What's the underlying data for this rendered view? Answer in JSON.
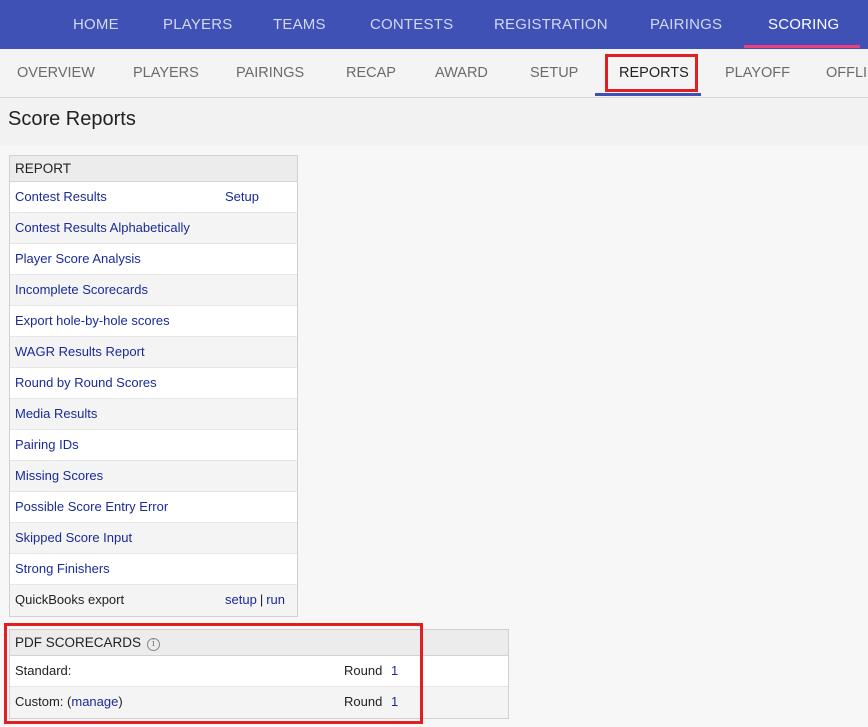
{
  "top_nav": {
    "items": [
      {
        "label": "HOME"
      },
      {
        "label": "PLAYERS"
      },
      {
        "label": "TEAMS"
      },
      {
        "label": "CONTESTS"
      },
      {
        "label": "REGISTRATION"
      },
      {
        "label": "PAIRINGS"
      },
      {
        "label": "SCORING",
        "active": true
      }
    ]
  },
  "sub_nav": {
    "items": [
      {
        "label": "OVERVIEW"
      },
      {
        "label": "PLAYERS"
      },
      {
        "label": "PAIRINGS"
      },
      {
        "label": "RECAP"
      },
      {
        "label": "AWARD"
      },
      {
        "label": "SETUP"
      },
      {
        "label": "REPORTS",
        "active": true
      },
      {
        "label": "PLAYOFF"
      },
      {
        "label": "OFFLI"
      }
    ]
  },
  "page": {
    "title": "Score Reports"
  },
  "report_panel": {
    "header": "REPORT",
    "rows": [
      {
        "label": "Contest Results",
        "setup": "Setup"
      },
      {
        "label": "Contest Results Alphabetically"
      },
      {
        "label": "Player Score Analysis"
      },
      {
        "label": "Incomplete Scorecards"
      },
      {
        "label": "Export hole-by-hole scores"
      },
      {
        "label": "WAGR Results Report"
      },
      {
        "label": "Round by Round Scores"
      },
      {
        "label": "Media Results"
      },
      {
        "label": "Pairing IDs"
      },
      {
        "label": "Missing Scores"
      },
      {
        "label": "Possible Score Entry Error"
      },
      {
        "label": "Skipped Score Input"
      },
      {
        "label": "Strong Finishers"
      }
    ],
    "quickbooks": {
      "label": "QuickBooks export",
      "setup": "setup",
      "sep": "|",
      "run": "run"
    }
  },
  "pdf_panel": {
    "header": "PDF SCORECARDS",
    "info_glyph": "i",
    "standard": {
      "label": "Standard:",
      "round_label": "Round",
      "round_value": "1"
    },
    "custom": {
      "label": "Custom:",
      "manage_open": "(",
      "manage": "manage",
      "manage_close": ")",
      "round_label": "Round",
      "round_value": "1"
    }
  },
  "colors": {
    "nav_bg": "#3f51b5",
    "nav_active_underline": "#e8417e",
    "highlight": "#e02020",
    "link": "#1a2a9a"
  }
}
